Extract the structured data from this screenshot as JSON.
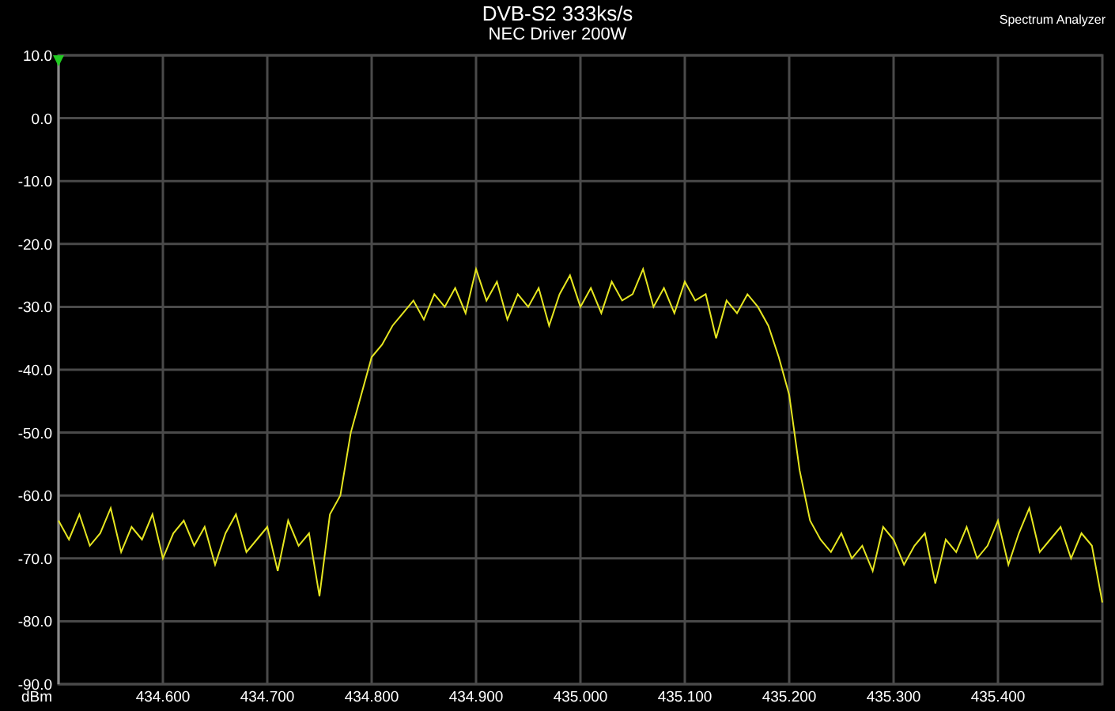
{
  "header": {
    "title": "DVB-S2 333ks/s",
    "subtitle": "NEC Driver 200W",
    "app_name": "Spectrum Analyzer"
  },
  "chart_data": {
    "type": "line",
    "grid": true,
    "ylabel": "dBm",
    "xlim": [
      434.5,
      435.5
    ],
    "ylim": [
      -90,
      10
    ],
    "xticks": [
      {
        "value": 434.6,
        "label": "434.600"
      },
      {
        "value": 434.7,
        "label": "434.700"
      },
      {
        "value": 434.8,
        "label": "434.800"
      },
      {
        "value": 434.9,
        "label": "434.900"
      },
      {
        "value": 435.0,
        "label": "435.000"
      },
      {
        "value": 435.1,
        "label": "435.100"
      },
      {
        "value": 435.2,
        "label": "435.200"
      },
      {
        "value": 435.3,
        "label": "435.300"
      },
      {
        "value": 435.4,
        "label": "435.400"
      }
    ],
    "yticks": [
      {
        "value": 10,
        "label": "10.0"
      },
      {
        "value": 0,
        "label": "0.0"
      },
      {
        "value": -10,
        "label": "-10.0"
      },
      {
        "value": -20,
        "label": "-20.0"
      },
      {
        "value": -30,
        "label": "-30.0"
      },
      {
        "value": -40,
        "label": "-40.0"
      },
      {
        "value": -50,
        "label": "-50.0"
      },
      {
        "value": -60,
        "label": "-60.0"
      },
      {
        "value": -70,
        "label": "-70.0"
      },
      {
        "value": -80,
        "label": "-80.0"
      },
      {
        "value": -90,
        "label": "-90.0"
      }
    ],
    "x": [
      434.5,
      434.51,
      434.52,
      434.53,
      434.54,
      434.55,
      434.56,
      434.57,
      434.58,
      434.59,
      434.6,
      434.61,
      434.62,
      434.63,
      434.64,
      434.65,
      434.66,
      434.67,
      434.68,
      434.69,
      434.7,
      434.71,
      434.72,
      434.73,
      434.74,
      434.75,
      434.76,
      434.77,
      434.78,
      434.79,
      434.8,
      434.81,
      434.82,
      434.83,
      434.84,
      434.85,
      434.86,
      434.87,
      434.88,
      434.89,
      434.9,
      434.91,
      434.92,
      434.93,
      434.94,
      434.95,
      434.96,
      434.97,
      434.98,
      434.99,
      435.0,
      435.01,
      435.02,
      435.03,
      435.04,
      435.05,
      435.06,
      435.07,
      435.08,
      435.09,
      435.1,
      435.11,
      435.12,
      435.13,
      435.14,
      435.15,
      435.16,
      435.17,
      435.18,
      435.19,
      435.2,
      435.21,
      435.22,
      435.23,
      435.24,
      435.25,
      435.26,
      435.27,
      435.28,
      435.29,
      435.3,
      435.31,
      435.32,
      435.33,
      435.34,
      435.35,
      435.36,
      435.37,
      435.38,
      435.39,
      435.4,
      435.41,
      435.42,
      435.43,
      435.44,
      435.45,
      435.46,
      435.47,
      435.48,
      435.49,
      435.5
    ],
    "series": [
      {
        "color": "#e6e620",
        "values": [
          -64,
          -67,
          -63,
          -68,
          -66,
          -62,
          -69,
          -65,
          -67,
          -63,
          -70,
          -66,
          -64,
          -68,
          -65,
          -71,
          -66,
          -63,
          -69,
          -67,
          -65,
          -72,
          -64,
          -68,
          -66,
          -76,
          -63,
          -60,
          -50,
          -44,
          -38,
          -36,
          -33,
          -31,
          -29,
          -32,
          -28,
          -30,
          -27,
          -31,
          -24,
          -29,
          -26,
          -32,
          -28,
          -30,
          -27,
          -33,
          -28,
          -25,
          -30,
          -27,
          -31,
          -26,
          -29,
          -28,
          -24,
          -30,
          -27,
          -31,
          -26,
          -29,
          -28,
          -35,
          -29,
          -31,
          -28,
          -30,
          -33,
          -38,
          -44,
          -56,
          -64,
          -67,
          -69,
          -66,
          -70,
          -68,
          -72,
          -65,
          -67,
          -71,
          -68,
          -66,
          -74,
          -67,
          -69,
          -65,
          -70,
          -68,
          -64,
          -71,
          -66,
          -62,
          -69,
          -67,
          -65,
          -70,
          -66,
          -68,
          -77
        ]
      }
    ]
  }
}
